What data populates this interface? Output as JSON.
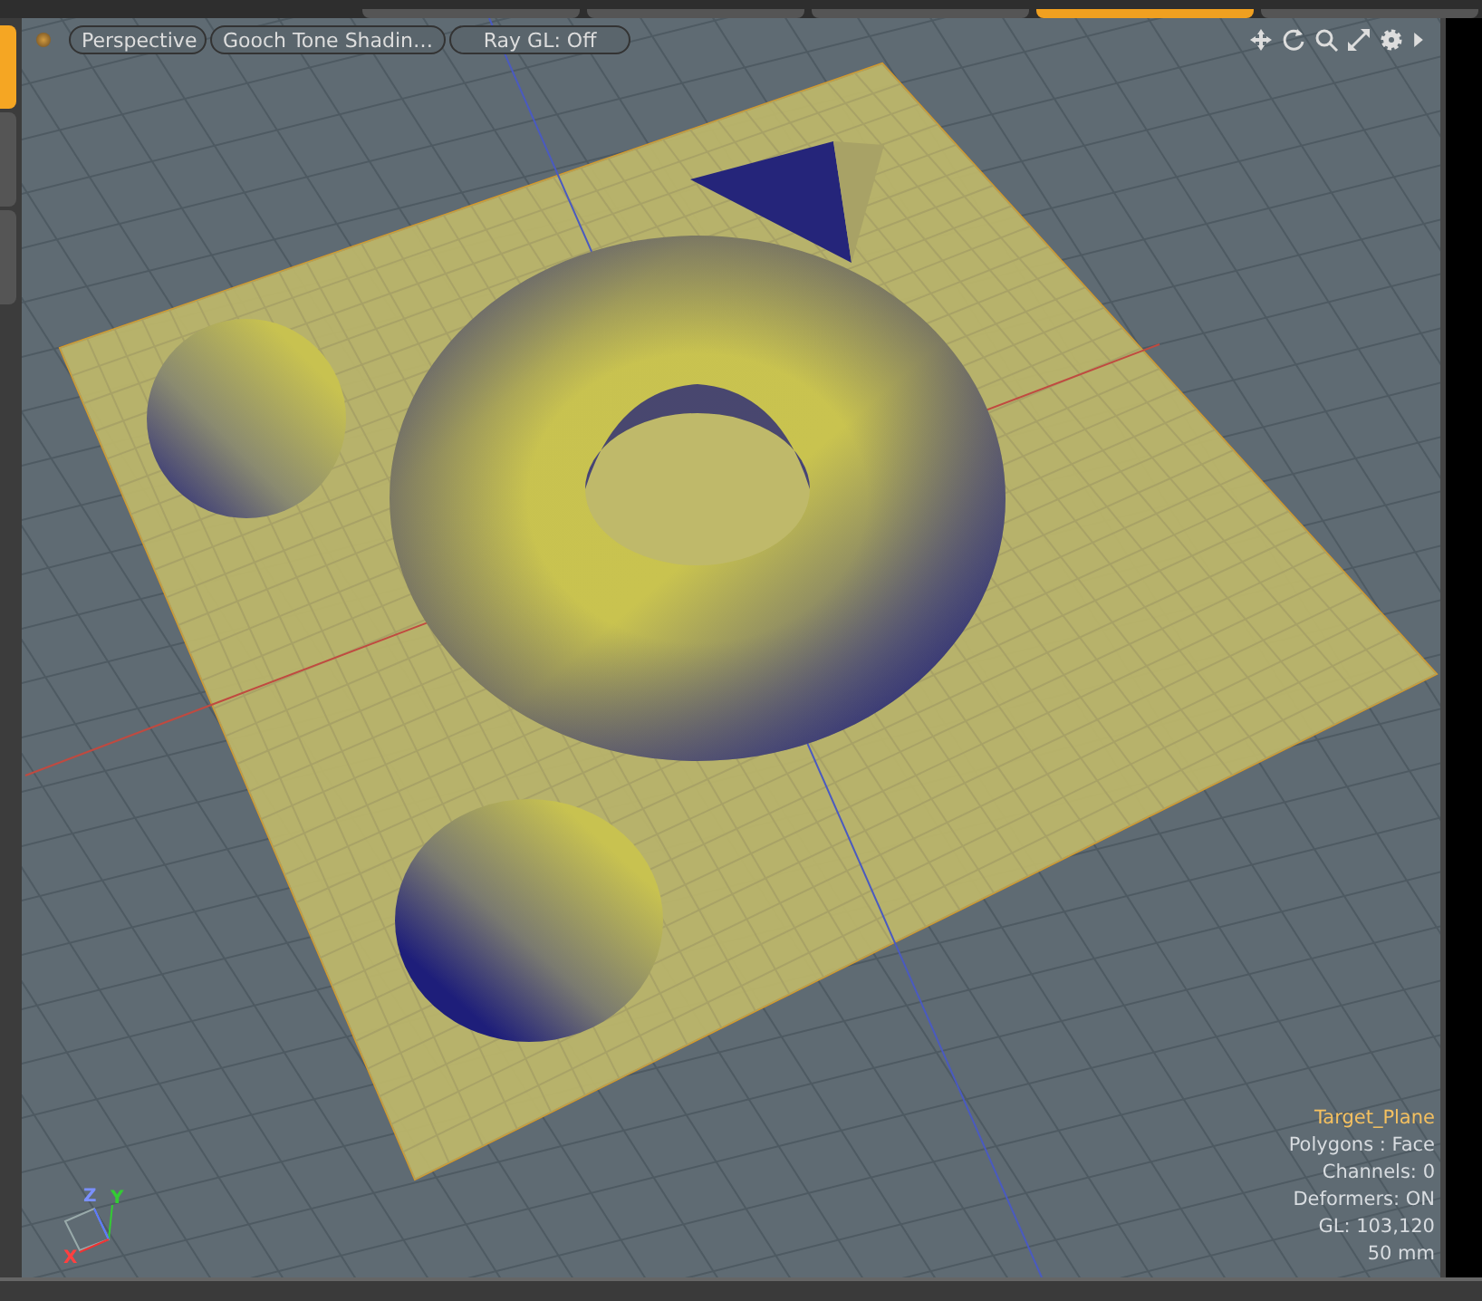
{
  "viewport": {
    "buttons": [
      {
        "label": "Perspective"
      },
      {
        "label": "Gooch Tone Shadin…"
      },
      {
        "label": "Ray GL: Off"
      }
    ],
    "info": {
      "item": "Target_Plane",
      "lines": [
        "Polygons : Face",
        "Channels: 0",
        "Deformers: ON",
        "GL: 103,120",
        "50 mm"
      ]
    },
    "axes": {
      "x": "X",
      "y": "Y",
      "z": "Z"
    }
  },
  "side_tabs": [
    {
      "selected": true
    },
    {
      "selected": false
    },
    {
      "selected": false
    }
  ]
}
